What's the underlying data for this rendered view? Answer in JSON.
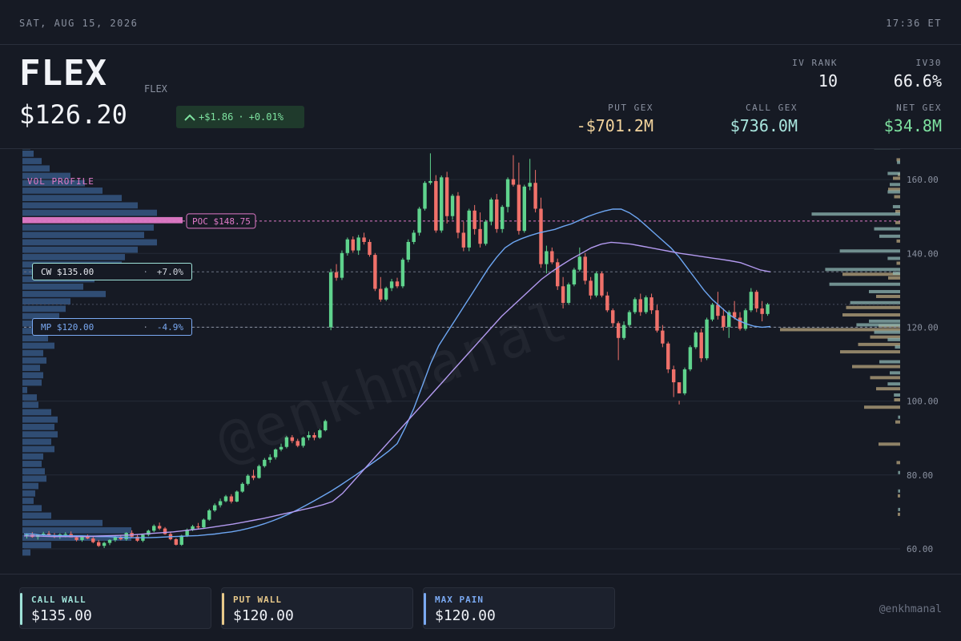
{
  "topbar": {
    "date": "SAT, AUG 15, 2026",
    "time": "17:36 ET"
  },
  "header": {
    "ticker": "FLEX",
    "company": "FLEX",
    "price": "$126.20",
    "change_abs": "+$1.86",
    "change_pct": "+0.01%",
    "stats": {
      "iv_rank_label": "IV RANK",
      "iv_rank": "10",
      "iv30_label": "IV30",
      "iv30": "66.6%",
      "put_gex_label": "PUT GEX",
      "put_gex": "-$701.2M",
      "call_gex_label": "CALL GEX",
      "call_gex": "$736.0M",
      "net_gex_label": "NET GEX",
      "net_gex": "$34.8M"
    }
  },
  "colors": {
    "up": "#5fd38d",
    "down": "#f0716a",
    "ma_fast": "#6da6f2",
    "ma_slow": "#b39af0",
    "poc": "#e07ac8",
    "call_wall": "#9fe3d9",
    "put_wall": "#e8c98a",
    "max_pain": "#7aa9f2",
    "net_positive": "#7ee2a0"
  },
  "chart_data": {
    "type": "candlestick",
    "ylim": [
      55,
      170
    ],
    "yticks": [
      "60.00",
      "80.00",
      "100.00",
      "120.00",
      "140.00",
      "160.00"
    ],
    "ytick_values": [
      60,
      80,
      100,
      120,
      140,
      160
    ],
    "candles": [
      [
        63.5,
        64.2,
        62.8,
        63.8
      ],
      [
        63.8,
        64.5,
        63.0,
        63.2
      ],
      [
        63.2,
        64.0,
        62.5,
        63.9
      ],
      [
        63.9,
        64.6,
        63.3,
        64.1
      ],
      [
        64.1,
        64.8,
        63.4,
        63.6
      ],
      [
        63.6,
        64.3,
        62.9,
        63.4
      ],
      [
        63.4,
        64.2,
        62.7,
        63.9
      ],
      [
        63.9,
        64.5,
        63.1,
        64.0
      ],
      [
        64.0,
        64.7,
        63.2,
        63.1
      ],
      [
        63.1,
        63.6,
        62.0,
        62.4
      ],
      [
        62.4,
        63.5,
        61.9,
        63.3
      ],
      [
        63.3,
        63.9,
        62.6,
        62.8
      ],
      [
        62.8,
        63.3,
        61.5,
        61.8
      ],
      [
        61.8,
        62.4,
        60.5,
        60.8
      ],
      [
        60.8,
        61.9,
        60.2,
        61.6
      ],
      [
        61.6,
        62.6,
        61.0,
        62.4
      ],
      [
        62.4,
        63.5,
        61.9,
        63.1
      ],
      [
        63.1,
        63.8,
        62.3,
        62.6
      ],
      [
        62.6,
        64.5,
        62.2,
        64.3
      ],
      [
        64.3,
        65.0,
        63.0,
        63.3
      ],
      [
        63.3,
        63.8,
        61.9,
        62.2
      ],
      [
        62.2,
        63.9,
        61.8,
        63.8
      ],
      [
        63.8,
        65.2,
        63.4,
        64.9
      ],
      [
        64.9,
        66.6,
        64.5,
        66.2
      ],
      [
        66.2,
        67.1,
        65.1,
        65.5
      ],
      [
        65.5,
        65.9,
        63.8,
        64.0
      ],
      [
        64.0,
        64.5,
        62.3,
        62.6
      ],
      [
        62.6,
        62.9,
        60.9,
        61.1
      ],
      [
        61.1,
        63.8,
        60.8,
        63.6
      ],
      [
        63.6,
        65.5,
        63.2,
        65.2
      ],
      [
        65.2,
        66.5,
        64.8,
        66.1
      ],
      [
        66.1,
        67.0,
        65.3,
        65.8
      ],
      [
        65.8,
        68.2,
        65.4,
        67.9
      ],
      [
        67.9,
        70.8,
        67.6,
        70.4
      ],
      [
        70.4,
        72.3,
        70.0,
        71.8
      ],
      [
        71.8,
        73.6,
        71.2,
        72.9
      ],
      [
        72.9,
        74.6,
        72.6,
        74.2
      ],
      [
        74.2,
        74.8,
        72.3,
        72.8
      ],
      [
        72.8,
        75.8,
        72.6,
        75.5
      ],
      [
        75.5,
        78.0,
        75.2,
        77.6
      ],
      [
        77.6,
        80.2,
        77.2,
        79.8
      ],
      [
        79.8,
        81.4,
        78.6,
        79.2
      ],
      [
        79.2,
        82.8,
        79.0,
        82.4
      ],
      [
        82.4,
        84.6,
        82.0,
        84.1
      ],
      [
        84.1,
        85.6,
        83.3,
        84.8
      ],
      [
        84.8,
        87.2,
        84.2,
        86.9
      ],
      [
        86.9,
        88.5,
        86.4,
        87.6
      ],
      [
        87.6,
        90.6,
        87.2,
        90.2
      ],
      [
        90.2,
        90.8,
        88.6,
        89.2
      ],
      [
        89.2,
        89.8,
        87.5,
        87.9
      ],
      [
        87.9,
        90.4,
        87.4,
        90.1
      ],
      [
        90.1,
        91.8,
        89.4,
        90.8
      ],
      [
        90.8,
        91.5,
        89.4,
        90.1
      ],
      [
        90.1,
        92.5,
        89.8,
        92.1
      ],
      [
        92.1,
        95.0,
        91.8,
        94.6
      ],
      [
        120.0,
        135.8,
        119.2,
        134.9
      ],
      [
        134.9,
        137.1,
        132.6,
        133.4
      ],
      [
        133.4,
        140.8,
        132.8,
        140.1
      ],
      [
        140.1,
        144.3,
        139.4,
        143.8
      ],
      [
        143.8,
        144.6,
        140.2,
        140.8
      ],
      [
        140.8,
        145.0,
        139.6,
        144.3
      ],
      [
        144.3,
        145.6,
        142.4,
        143.1
      ],
      [
        143.1,
        143.8,
        139.1,
        139.6
      ],
      [
        139.6,
        140.1,
        129.8,
        130.4
      ],
      [
        130.4,
        133.6,
        126.9,
        127.5
      ],
      [
        127.5,
        131.0,
        127.1,
        130.6
      ],
      [
        130.6,
        133.1,
        129.8,
        132.4
      ],
      [
        132.4,
        133.4,
        130.6,
        131.1
      ],
      [
        131.1,
        138.8,
        130.6,
        138.3
      ],
      [
        138.3,
        143.8,
        137.6,
        143.1
      ],
      [
        143.1,
        146.3,
        142.5,
        145.6
      ],
      [
        145.6,
        152.6,
        144.8,
        152.1
      ],
      [
        152.1,
        159.6,
        151.6,
        159.1
      ],
      [
        159.1,
        167.1,
        158.6,
        159.6
      ],
      [
        159.6,
        161.2,
        145.6,
        146.2
      ],
      [
        146.2,
        161.1,
        145.6,
        160.6
      ],
      [
        160.6,
        162.1,
        148.1,
        150.1
      ],
      [
        150.1,
        156.1,
        149.1,
        155.6
      ],
      [
        155.6,
        156.6,
        144.1,
        145.6
      ],
      [
        145.6,
        148.6,
        140.6,
        141.6
      ],
      [
        141.6,
        152.1,
        140.6,
        151.6
      ],
      [
        151.6,
        153.1,
        145.1,
        146.6
      ],
      [
        146.6,
        151.1,
        141.6,
        142.6
      ],
      [
        142.6,
        149.1,
        142.1,
        148.6
      ],
      [
        148.6,
        155.1,
        147.6,
        154.6
      ],
      [
        154.6,
        156.1,
        145.6,
        146.6
      ],
      [
        146.6,
        153.1,
        145.6,
        152.6
      ],
      [
        152.6,
        160.6,
        151.1,
        160.1
      ],
      [
        160.1,
        166.6,
        158.1,
        158.6
      ],
      [
        158.6,
        164.6,
        145.1,
        146.1
      ],
      [
        146.1,
        158.6,
        145.6,
        158.1
      ],
      [
        158.1,
        165.6,
        157.1,
        159.1
      ],
      [
        159.1,
        162.6,
        151.1,
        152.1
      ],
      [
        152.1,
        155.1,
        136.1,
        137.1
      ],
      [
        137.1,
        142.1,
        134.6,
        140.6
      ],
      [
        140.6,
        141.6,
        137.1,
        137.6
      ],
      [
        137.6,
        138.6,
        130.1,
        131.1
      ],
      [
        131.1,
        133.6,
        125.1,
        126.6
      ],
      [
        126.6,
        132.1,
        126.1,
        131.6
      ],
      [
        131.6,
        136.1,
        131.1,
        135.6
      ],
      [
        135.6,
        141.6,
        135.1,
        139.1
      ],
      [
        139.1,
        140.1,
        131.6,
        132.6
      ],
      [
        132.6,
        133.6,
        127.6,
        128.6
      ],
      [
        128.6,
        135.1,
        128.1,
        134.6
      ],
      [
        134.6,
        135.1,
        128.1,
        128.6
      ],
      [
        128.6,
        129.6,
        124.1,
        124.6
      ],
      [
        124.6,
        125.1,
        120.1,
        121.1
      ],
      [
        121.1,
        121.6,
        111.1,
        117.1
      ],
      [
        117.1,
        121.6,
        116.6,
        120.6
      ],
      [
        120.6,
        124.6,
        120.1,
        124.1
      ],
      [
        124.1,
        128.1,
        123.6,
        127.6
      ],
      [
        127.6,
        129.1,
        123.1,
        124.1
      ],
      [
        124.1,
        128.6,
        123.6,
        128.1
      ],
      [
        128.1,
        129.1,
        123.6,
        124.6
      ],
      [
        124.6,
        126.1,
        118.6,
        119.1
      ],
      [
        119.1,
        120.6,
        114.6,
        115.6
      ],
      [
        115.6,
        116.1,
        107.6,
        108.6
      ],
      [
        108.6,
        109.6,
        101.1,
        105.1
      ],
      [
        105.1,
        100.1,
        99.1,
        102.1
      ],
      [
        102.1,
        109.1,
        101.6,
        108.6
      ],
      [
        108.6,
        115.1,
        108.1,
        114.6
      ],
      [
        114.6,
        119.1,
        114.1,
        118.6
      ],
      [
        118.6,
        119.6,
        110.6,
        111.6
      ],
      [
        111.6,
        122.6,
        111.1,
        122.1
      ],
      [
        122.1,
        126.6,
        121.6,
        126.1
      ],
      [
        126.1,
        129.6,
        122.1,
        123.1
      ],
      [
        123.1,
        125.1,
        119.1,
        120.1
      ],
      [
        120.1,
        124.6,
        117.1,
        124.1
      ],
      [
        124.1,
        127.1,
        122.1,
        122.6
      ],
      [
        122.6,
        124.1,
        119.1,
        119.6
      ],
      [
        119.6,
        125.1,
        119.1,
        124.6
      ],
      [
        124.6,
        130.6,
        124.1,
        129.6
      ],
      [
        129.6,
        130.1,
        124.1,
        125.1
      ],
      [
        125.1,
        127.1,
        121.6,
        123.6
      ],
      [
        123.6,
        126.6,
        123.1,
        126.2
      ]
    ],
    "ma_fast": [
      64,
      64,
      63.8,
      63.7,
      63.6,
      63.6,
      63.5,
      63.5,
      63.4,
      63.3,
      63.3,
      63.2,
      63.1,
      63,
      63,
      63,
      63.1,
      63.2,
      63.3,
      63.4,
      63.5,
      63.6,
      63.8,
      64,
      64.3,
      64.6,
      65,
      65.5,
      66.1,
      66.8,
      67.6,
      68.5,
      69.5,
      70.6,
      71.8,
      73,
      74.3,
      75.6,
      77,
      78.5,
      80,
      81.6,
      83.2,
      84.8,
      86.5,
      88.5,
      93,
      98,
      104,
      110,
      115,
      118.5,
      122,
      125.5,
      129,
      132.5,
      136,
      139,
      141.5,
      143,
      144,
      144.8,
      145.5,
      146,
      146.5,
      147.3,
      148,
      149,
      150,
      150.8,
      151.5,
      152,
      152,
      151,
      149.5,
      147.5,
      145.5,
      143.5,
      141.5,
      139,
      136,
      133,
      130,
      127.5,
      125.5,
      123.5,
      122,
      121,
      120.3,
      120,
      120.2
    ],
    "ma_slow": [
      63.5,
      63.5,
      63.4,
      63.3,
      63.3,
      63.3,
      63.3,
      63.4,
      63.5,
      63.6,
      63.7,
      63.8,
      64,
      64.2,
      64.4,
      64.6,
      64.9,
      65.2,
      65.5,
      65.9,
      66.3,
      66.7,
      67.2,
      67.7,
      68.2,
      68.8,
      69.4,
      70,
      70.6,
      71.2,
      71.9,
      72.8,
      75,
      78,
      81,
      84,
      87,
      90,
      93,
      96,
      99,
      102,
      105,
      108,
      111,
      114,
      117,
      120,
      123,
      125.5,
      128,
      130.5,
      133,
      135,
      136.8,
      138.5,
      140,
      141.5,
      142.5,
      143,
      142.8,
      142.5,
      142,
      141.5,
      141,
      140.5,
      140,
      139.6,
      139.2,
      138.8,
      138.4,
      138,
      137.5,
      136.5,
      135.5,
      135
    ],
    "poc": {
      "label": "POC $148.75",
      "value": 148.75
    },
    "call_wall": {
      "label": "CW $135.00",
      "value": 135,
      "pct": "+7.0%"
    },
    "max_pain": {
      "label": "MP $120.00",
      "value": 120,
      "pct": "-4.9%"
    },
    "price_line": 126.2,
    "vol_profile_label": "VOL PROFILE",
    "vol_profile": [
      {
        "p": 169,
        "v": 0.05
      },
      {
        "p": 167,
        "v": 0.07
      },
      {
        "p": 165,
        "v": 0.12
      },
      {
        "p": 163,
        "v": 0.17
      },
      {
        "p": 161,
        "v": 0.3
      },
      {
        "p": 159,
        "v": 0.39
      },
      {
        "p": 157,
        "v": 0.5
      },
      {
        "p": 155,
        "v": 0.62
      },
      {
        "p": 153,
        "v": 0.72
      },
      {
        "p": 151,
        "v": 0.84
      },
      {
        "p": 149,
        "v": 1.0
      },
      {
        "p": 147,
        "v": 0.82
      },
      {
        "p": 145,
        "v": 0.76
      },
      {
        "p": 143,
        "v": 0.84
      },
      {
        "p": 141,
        "v": 0.72
      },
      {
        "p": 139,
        "v": 0.64
      },
      {
        "p": 137,
        "v": 0.62
      },
      {
        "p": 135,
        "v": 0.52
      },
      {
        "p": 133,
        "v": 0.45
      },
      {
        "p": 131,
        "v": 0.38
      },
      {
        "p": 129,
        "v": 0.52
      },
      {
        "p": 127,
        "v": 0.3
      },
      {
        "p": 125,
        "v": 0.27
      },
      {
        "p": 123,
        "v": 0.23
      },
      {
        "p": 121,
        "v": 0.2
      },
      {
        "p": 119,
        "v": 0.18
      },
      {
        "p": 117,
        "v": 0.16
      },
      {
        "p": 115,
        "v": 0.2
      },
      {
        "p": 113,
        "v": 0.13
      },
      {
        "p": 111,
        "v": 0.15
      },
      {
        "p": 109,
        "v": 0.11
      },
      {
        "p": 107,
        "v": 0.13
      },
      {
        "p": 105,
        "v": 0.12
      },
      {
        "p": 103,
        "v": 0.03
      },
      {
        "p": 101,
        "v": 0.09
      },
      {
        "p": 99,
        "v": 0.1
      },
      {
        "p": 97,
        "v": 0.18
      },
      {
        "p": 95,
        "v": 0.22
      },
      {
        "p": 93,
        "v": 0.2
      },
      {
        "p": 91,
        "v": 0.22
      },
      {
        "p": 89,
        "v": 0.18
      },
      {
        "p": 87,
        "v": 0.2
      },
      {
        "p": 85,
        "v": 0.13
      },
      {
        "p": 83,
        "v": 0.12
      },
      {
        "p": 81,
        "v": 0.14
      },
      {
        "p": 79,
        "v": 0.15
      },
      {
        "p": 77,
        "v": 0.1
      },
      {
        "p": 75,
        "v": 0.08
      },
      {
        "p": 73,
        "v": 0.07
      },
      {
        "p": 71,
        "v": 0.12
      },
      {
        "p": 69,
        "v": 0.18
      },
      {
        "p": 67,
        "v": 0.5
      },
      {
        "p": 65,
        "v": 0.68
      },
      {
        "p": 63,
        "v": 0.68
      },
      {
        "p": 61,
        "v": 0.18
      },
      {
        "p": 59,
        "v": 0.05
      }
    ],
    "gex_profile": [
      {
        "p": 168,
        "call": 0.25,
        "put": 0
      },
      {
        "p": 166,
        "call": 0,
        "put": 0.03
      },
      {
        "p": 164,
        "call": 0.03,
        "put": 0
      },
      {
        "p": 162,
        "call": 0,
        "put": 0.02
      },
      {
        "p": 161,
        "call": 0.12,
        "put": 0.06
      },
      {
        "p": 158,
        "call": 0.1,
        "put": 0.1
      },
      {
        "p": 156,
        "call": 0.12,
        "put": 0.05
      },
      {
        "p": 152,
        "call": 0.07,
        "put": 0.04
      },
      {
        "p": 150,
        "call": 0.85,
        "put": 0
      },
      {
        "p": 149,
        "call": 0,
        "put": 0.04
      },
      {
        "p": 146,
        "call": 0.25,
        "put": 0
      },
      {
        "p": 144,
        "call": 0.2,
        "put": 0.03
      },
      {
        "p": 140,
        "call": 0.58,
        "put": 0
      },
      {
        "p": 138,
        "call": 0.12,
        "put": 0.03
      },
      {
        "p": 135,
        "call": 0.72,
        "put": 0.48
      },
      {
        "p": 134,
        "call": 0.07,
        "put": 0.1
      },
      {
        "p": 131,
        "call": 0.68,
        "put": 0
      },
      {
        "p": 129,
        "call": 0.3,
        "put": 0.2
      },
      {
        "p": 126,
        "call": 0.48,
        "put": 0.45
      },
      {
        "p": 124,
        "call": 0,
        "put": 0.48
      },
      {
        "p": 121,
        "call": 0.3,
        "put": 0.18
      },
      {
        "p": 120,
        "call": 0.42,
        "put": 1.0
      },
      {
        "p": 118,
        "call": 0.25,
        "put": 0.25
      },
      {
        "p": 116,
        "call": 0.12,
        "put": 0.35
      },
      {
        "p": 114,
        "call": 0.05,
        "put": 0.5
      },
      {
        "p": 110,
        "call": 0.2,
        "put": 0.4
      },
      {
        "p": 107,
        "call": 0.1,
        "put": 0.25
      },
      {
        "p": 104,
        "call": 0.12,
        "put": 0.2
      },
      {
        "p": 101,
        "call": 0.06,
        "put": 0.05
      },
      {
        "p": 99,
        "call": 0,
        "put": 0.3
      },
      {
        "p": 95,
        "call": 0.02,
        "put": 0.04
      },
      {
        "p": 89,
        "call": 0,
        "put": 0.18
      },
      {
        "p": 84,
        "call": 0,
        "put": 0.03
      },
      {
        "p": 80,
        "call": 0.02,
        "put": 0
      },
      {
        "p": 75,
        "call": 0.02,
        "put": 0.02
      },
      {
        "p": 70,
        "call": 0.02,
        "put": 0.02
      }
    ]
  },
  "footer": {
    "call_wall_label": "CALL WALL",
    "call_wall_value": "$135.00",
    "put_wall_label": "PUT WALL",
    "put_wall_value": "$120.00",
    "max_pain_label": "MAX PAIN",
    "max_pain_value": "$120.00",
    "handle": "@enkhmanal"
  },
  "watermark": "@enkhmanal"
}
